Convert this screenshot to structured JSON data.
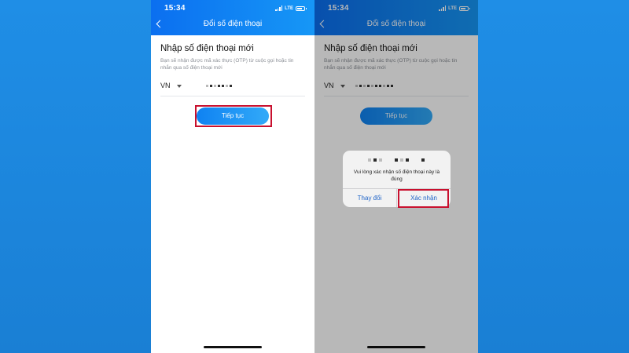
{
  "colors": {
    "background_blue": "#1b86db",
    "header_blue": "#0b6ff0",
    "button_blue": "#1a8ff4",
    "highlight_red": "#c8102e",
    "dialog_link": "#1f64c8"
  },
  "status_bar": {
    "time": "15:34",
    "network": "LTE"
  },
  "screen_left": {
    "nav_title": "Đổi số điện thoại",
    "heading": "Nhập số điện thoại mới",
    "description": "Bạn sẽ nhận được mã xác thực (OTP) từ cuộc gọi hoặc tin nhắn qua số điện thoại mới",
    "country_code": "VN",
    "continue_label": "Tiếp tục"
  },
  "screen_right": {
    "nav_title": "Đổi số điện thoại",
    "heading": "Nhập số điện thoại mới",
    "description": "Bạn sẽ nhận được mã xác thực (OTP) từ cuộc gọi hoặc tin nhắn qua số điện thoại mới",
    "country_code": "VN",
    "continue_label": "Tiếp tục",
    "dialog": {
      "message": "Vui lòng xác nhận số điện thoại này là đúng",
      "change_label": "Thay đổi",
      "confirm_label": "Xác nhận"
    }
  },
  "icons": [
    "back-chevron-icon",
    "signal-icon",
    "battery-icon",
    "dropdown-caret-icon"
  ]
}
